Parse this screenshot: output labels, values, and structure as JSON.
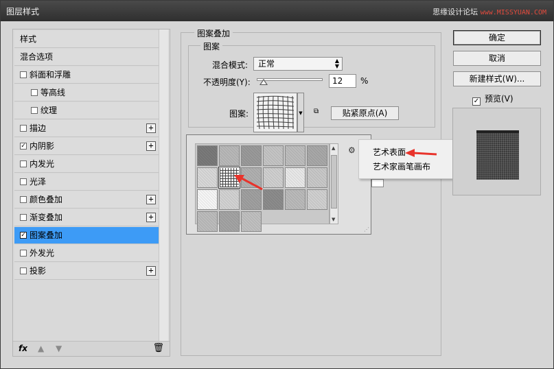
{
  "window": {
    "title": "图层样式"
  },
  "watermark": {
    "text": "思缘设计论坛",
    "url": "www.MISSYUAN.COM"
  },
  "sidebar": {
    "items": [
      {
        "label": "样式",
        "checkbox": false,
        "checked": false,
        "plus": false,
        "indent": 0
      },
      {
        "label": "混合选项",
        "checkbox": false,
        "checked": false,
        "plus": false,
        "indent": 0
      },
      {
        "label": "斜面和浮雕",
        "checkbox": true,
        "checked": false,
        "plus": false,
        "indent": 0
      },
      {
        "label": "等高线",
        "checkbox": true,
        "checked": false,
        "plus": false,
        "indent": 1
      },
      {
        "label": "纹理",
        "checkbox": true,
        "checked": false,
        "plus": false,
        "indent": 1
      },
      {
        "label": "描边",
        "checkbox": true,
        "checked": false,
        "plus": true,
        "indent": 0
      },
      {
        "label": "内阴影",
        "checkbox": true,
        "checked": true,
        "plus": true,
        "indent": 0
      },
      {
        "label": "内发光",
        "checkbox": true,
        "checked": false,
        "plus": false,
        "indent": 0
      },
      {
        "label": "光泽",
        "checkbox": true,
        "checked": false,
        "plus": false,
        "indent": 0
      },
      {
        "label": "颜色叠加",
        "checkbox": true,
        "checked": false,
        "plus": true,
        "indent": 0
      },
      {
        "label": "渐变叠加",
        "checkbox": true,
        "checked": false,
        "plus": true,
        "indent": 0
      },
      {
        "label": "图案叠加",
        "checkbox": true,
        "checked": true,
        "plus": false,
        "indent": 0,
        "selected": true
      },
      {
        "label": "外发光",
        "checkbox": true,
        "checked": false,
        "plus": false,
        "indent": 0
      },
      {
        "label": "投影",
        "checkbox": true,
        "checked": false,
        "plus": true,
        "indent": 0
      }
    ],
    "footer": {
      "fx_label": "fx",
      "up_icon": "arrow-up-icon",
      "down_icon": "arrow-down-icon",
      "trash_icon": "trash-icon"
    }
  },
  "panel": {
    "title": "图案叠加",
    "group_title": "图案",
    "blend_mode_label": "混合模式:",
    "blend_mode_value": "正常",
    "opacity_label": "不透明度(Y):",
    "opacity_value": "12",
    "opacity_unit": "%",
    "pattern_label": "图案:",
    "snap_button": "贴紧原点(A)"
  },
  "context_menu": {
    "items": [
      "艺术表面",
      "艺术家画笔画布"
    ]
  },
  "buttons": {
    "ok": "确定",
    "cancel": "取消",
    "new_style": "新建样式(W)...",
    "preview_label": "预览(V)",
    "preview_checked": true
  },
  "colors": {
    "selected_row": "#3d9bf6",
    "annotation_arrow": "#e8332b",
    "dialog_bg": "#d6d6d6"
  }
}
